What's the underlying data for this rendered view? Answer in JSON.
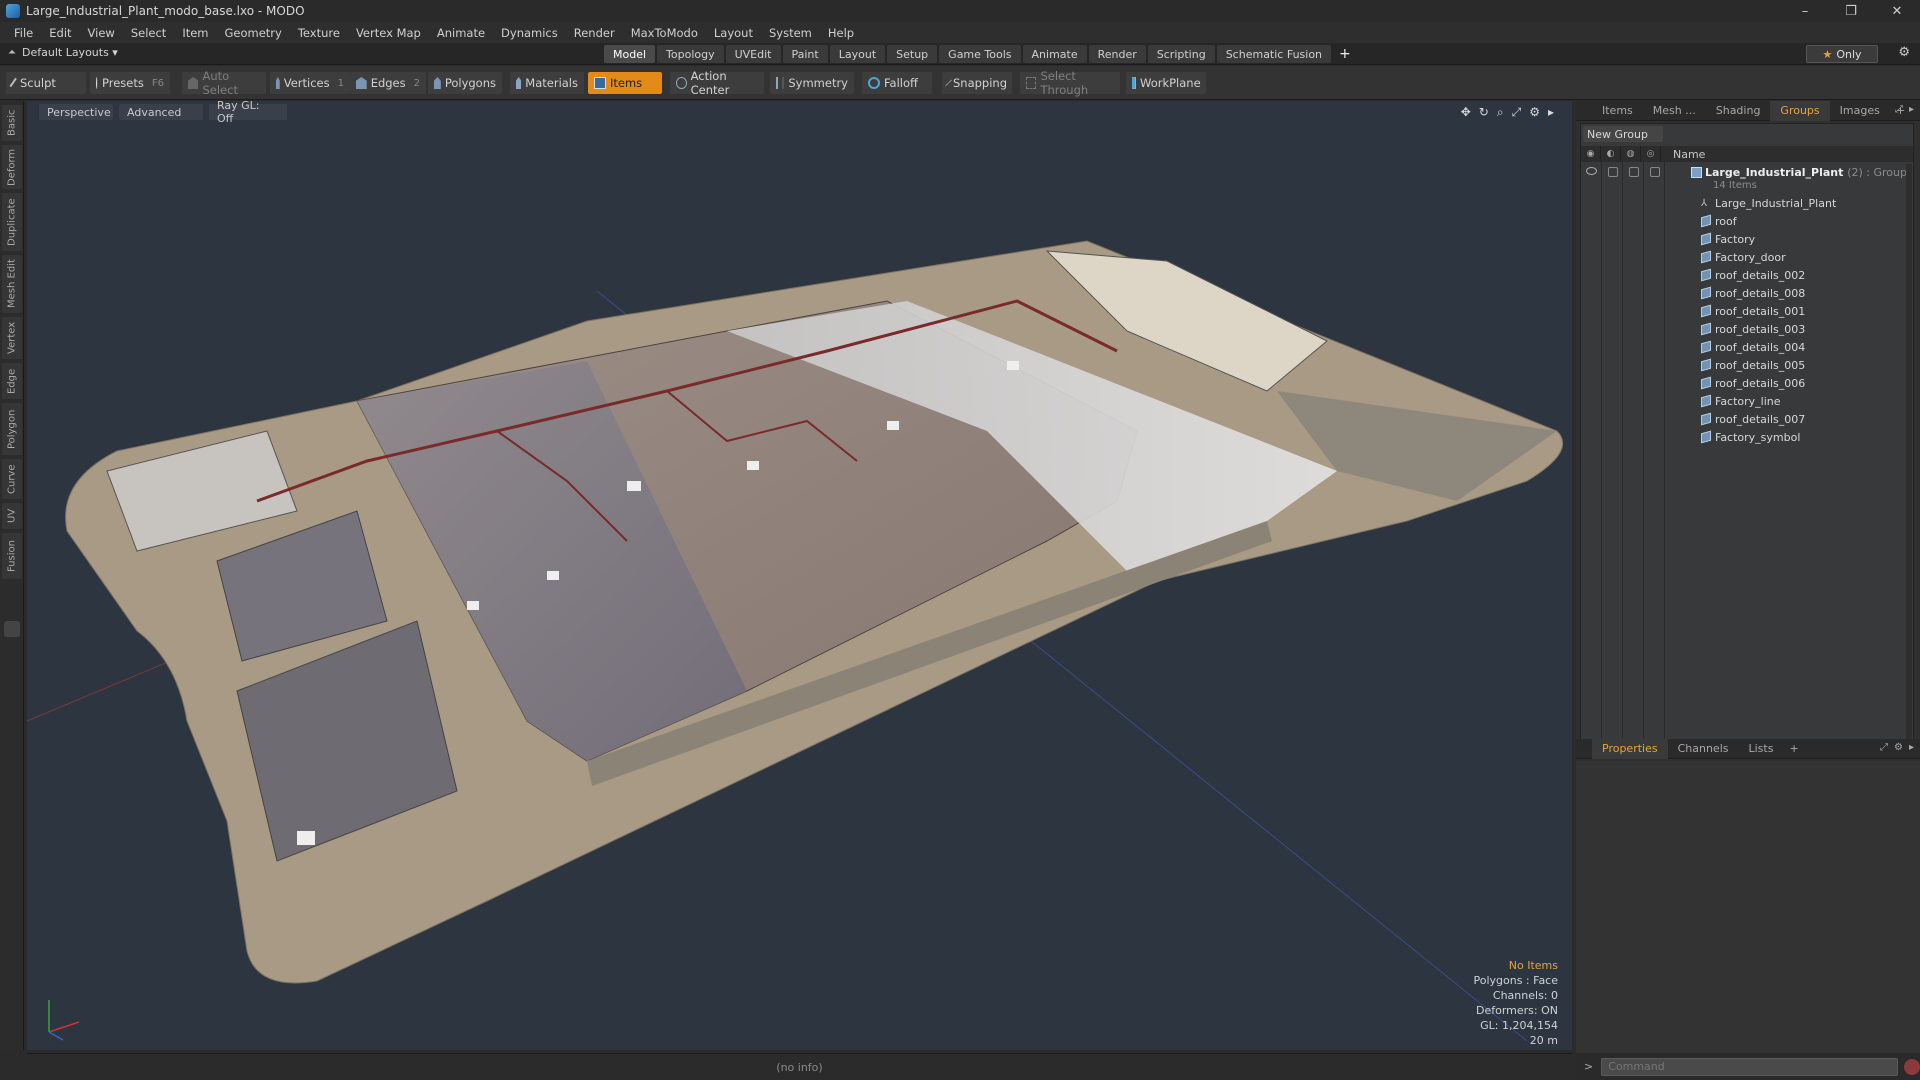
{
  "window": {
    "title": "Large_Industrial_Plant_modo_base.lxo - MODO",
    "controls": [
      "–",
      "❐",
      "✕"
    ]
  },
  "menu": [
    "File",
    "Edit",
    "View",
    "Select",
    "Item",
    "Geometry",
    "Texture",
    "Vertex Map",
    "Animate",
    "Dynamics",
    "Render",
    "MaxToModo",
    "Layout",
    "System",
    "Help"
  ],
  "layout_bar": {
    "layout_label": "Default Layouts ▾",
    "tabs": [
      "Model",
      "Topology",
      "UVEdit",
      "Paint",
      "Layout",
      "Setup",
      "Game Tools",
      "Animate",
      "Render",
      "Scripting",
      "Schematic Fusion"
    ],
    "active_tab": "Model",
    "plus": "+",
    "only_label": "Only",
    "star": "★"
  },
  "toolbar": {
    "sculpt": "Sculpt",
    "presets": "Presets",
    "presets_key": "F6",
    "auto_select": "Auto Select",
    "vertices": "Vertices",
    "vertices_key": "1",
    "edges": "Edges",
    "edges_key": "2",
    "polygons": "Polygons",
    "materials": "Materials",
    "items": "Items",
    "action_center": "Action Center",
    "symmetry": "Symmetry",
    "falloff": "Falloff",
    "snapping": "Snapping",
    "select_through": "Select Through",
    "workplane": "WorkPlane"
  },
  "left_tabs": [
    "Basic",
    "Deform",
    "Duplicate",
    "Mesh Edit",
    "Vertex",
    "Edge",
    "Polygon",
    "Curve",
    "UV",
    "Fusion"
  ],
  "viewport": {
    "view": "Perspective",
    "shading": "Advanced",
    "raygl": "Ray GL: Off",
    "hud": {
      "selection": "No Items",
      "mode": "Polygons : Face",
      "channels": "Channels: 0",
      "deformers": "Deformers: ON",
      "gl": "GL: 1,204,154",
      "scale": "20 m"
    }
  },
  "status": "(no info)",
  "right_panel": {
    "top_tabs": [
      "Items",
      "Mesh ...",
      "Shading",
      "Groups",
      "Images"
    ],
    "active_top_tab": "Groups",
    "new_group": "New Group",
    "column_name": "Name",
    "group": {
      "name": "Large_Industrial_Plant",
      "suffix": "(2) : Group",
      "count": "14 Items"
    },
    "items": [
      {
        "name": "Large_Industrial_Plant",
        "type": "locator"
      },
      {
        "name": "roof",
        "type": "mesh"
      },
      {
        "name": "Factory",
        "type": "mesh"
      },
      {
        "name": "Factory_door",
        "type": "mesh"
      },
      {
        "name": "roof_details_002",
        "type": "mesh"
      },
      {
        "name": "roof_details_008",
        "type": "mesh"
      },
      {
        "name": "roof_details_001",
        "type": "mesh"
      },
      {
        "name": "roof_details_003",
        "type": "mesh"
      },
      {
        "name": "roof_details_004",
        "type": "mesh"
      },
      {
        "name": "roof_details_005",
        "type": "mesh"
      },
      {
        "name": "roof_details_006",
        "type": "mesh"
      },
      {
        "name": "Factory_line",
        "type": "mesh"
      },
      {
        "name": "roof_details_007",
        "type": "mesh"
      },
      {
        "name": "Factory_symbol",
        "type": "mesh"
      }
    ],
    "bottom_tabs": [
      "Properties",
      "Channels",
      "Lists"
    ],
    "active_bottom_tab": "Properties",
    "command_placeholder": "Command"
  },
  "colors": {
    "accent": "#e8a33a",
    "items_active": "#e48a17",
    "viewport_bg": "#2c3540"
  }
}
